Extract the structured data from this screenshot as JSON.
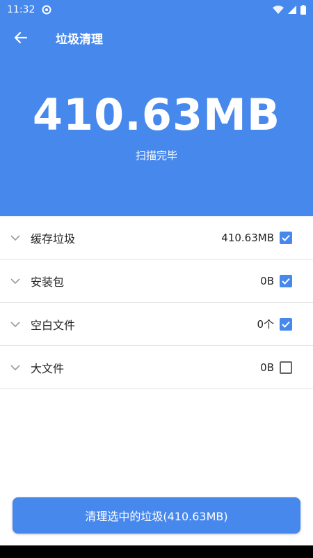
{
  "status_bar": {
    "time": "11:32"
  },
  "app_bar": {
    "title": "垃圾清理"
  },
  "hero": {
    "total_size": "410.63MB",
    "status": "扫描完毕"
  },
  "items": [
    {
      "label": "缓存垃圾",
      "value": "410.63MB",
      "checked": true
    },
    {
      "label": "安装包",
      "value": "0B",
      "checked": true
    },
    {
      "label": "空白文件",
      "value": "0个",
      "checked": true
    },
    {
      "label": "大文件",
      "value": "0B",
      "checked": false
    }
  ],
  "action": {
    "clean_label": "清理选中的垃圾(410.63MB)"
  },
  "colors": {
    "primary": "#4788ED"
  }
}
